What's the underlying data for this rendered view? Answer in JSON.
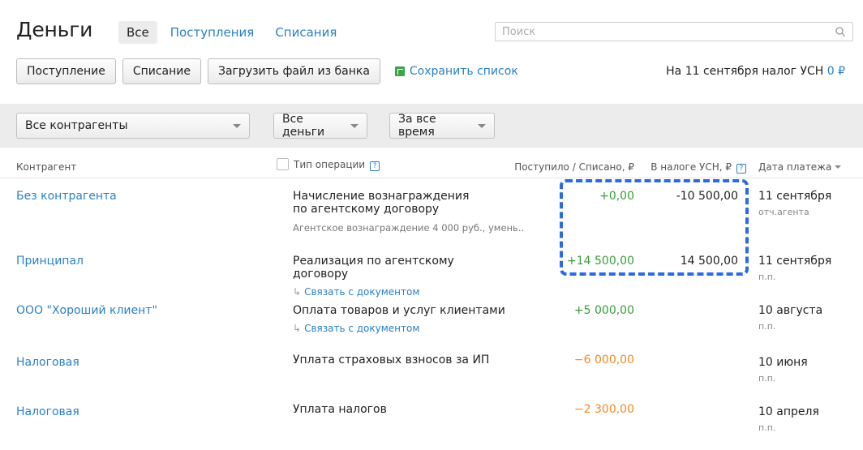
{
  "header": {
    "title": "Деньги",
    "tabs": [
      {
        "label": "Все",
        "active": true
      },
      {
        "label": "Поступления",
        "active": false
      },
      {
        "label": "Списания",
        "active": false
      }
    ],
    "search_placeholder": "Поиск"
  },
  "toolbar": {
    "incoming_label": "Поступление",
    "outgoing_label": "Списание",
    "upload_label": "Загрузить файл из банка",
    "save_list_label": "Сохранить список",
    "tax_text": "На 11 сентября налог УСН",
    "tax_amount": "0 ₽"
  },
  "filters": {
    "counterparty": "Все контрагенты",
    "money": "Все деньги",
    "period": "За все время"
  },
  "table": {
    "headers": {
      "counterparty": "Контрагент",
      "operation": "Тип операции",
      "amount": "Поступило / Списано, ₽",
      "tax": "В налоге УСН, ₽",
      "date": "Дата платежа"
    },
    "rows": [
      {
        "counterparty": "Без контрагента",
        "operation": "Начисление вознаграждения по агентскому договору",
        "note": "Агентское вознаграждение 4 000 руб., умень...",
        "link": "",
        "amount": "+0,00",
        "tax": "-10 500,00",
        "date": "11 сентября",
        "doc": "отч.агента"
      },
      {
        "counterparty": "Принципал",
        "operation": "Реализация по агентскому договору",
        "note": "",
        "link": "Связать с документом",
        "amount": "+14 500,00",
        "tax": "14 500,00",
        "date": "11 сентября",
        "doc": "п.п."
      },
      {
        "counterparty": "ООО \"Хороший клиент\"",
        "operation": "Оплата товаров и услуг клиентами",
        "note": "",
        "link": "Связать с документом",
        "amount": "+5 000,00",
        "tax": "",
        "date": "10 августа",
        "doc": "п.п."
      },
      {
        "counterparty": "Налоговая",
        "operation": "Уплата страховых взносов за ИП",
        "note": "",
        "link": "",
        "amount": "−6 000,00",
        "tax": "",
        "date": "10 июня",
        "doc": "п.п."
      },
      {
        "counterparty": "Налоговая",
        "operation": "Уплата налогов",
        "note": "",
        "link": "",
        "amount": "−2 300,00",
        "tax": "",
        "date": "10 апреля",
        "doc": "п.п."
      }
    ]
  },
  "colors": {
    "link": "#2a7fc4",
    "income": "#3a9a3a",
    "expense": "#f08a24",
    "highlight": "#2b6ae0"
  }
}
